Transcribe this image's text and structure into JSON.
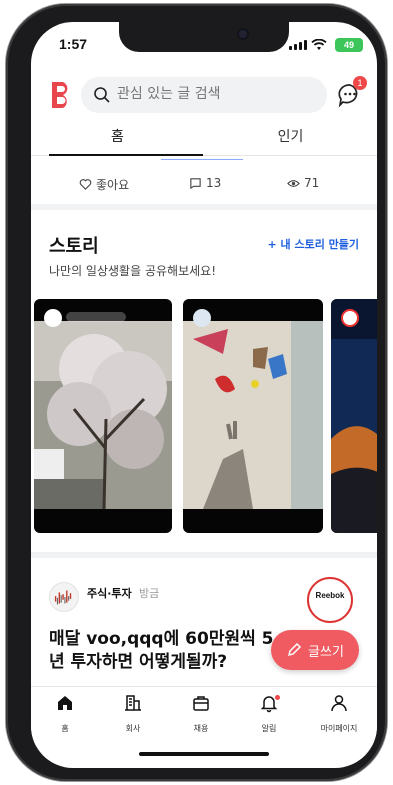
{
  "status_bar": {
    "time": "1:57",
    "battery": "49"
  },
  "header": {
    "search_placeholder": "관심 있는 글 검색",
    "chat_badge": "1"
  },
  "tabs": [
    {
      "label": "홈"
    },
    {
      "label": "인기"
    }
  ],
  "post_actions": {
    "like_label": "좋아요",
    "comment_count": "13",
    "view_count": "71"
  },
  "stories": {
    "title": "스토리",
    "make_button": "+ 내 스토리 만들기",
    "subtitle": "나만의 일상생활을 공유해보세요!"
  },
  "post": {
    "category": "주식·투자",
    "status": "방금",
    "title": "매달 voo,qqq에 60만원씩 5년 투자하면 어떻게될까?"
  },
  "ad": {
    "brand": "Reebok"
  },
  "write_button": {
    "label": "글쓰기"
  },
  "bottom_nav": [
    {
      "label": "홈",
      "icon": "home-icon"
    },
    {
      "label": "회사",
      "icon": "building-icon"
    },
    {
      "label": "채용",
      "icon": "briefcase-icon"
    },
    {
      "label": "알림",
      "icon": "bell-icon"
    },
    {
      "label": "마이페이지",
      "icon": "person-icon"
    }
  ],
  "colors": {
    "accent": "#f05b61",
    "link": "#1e5fe0",
    "brand_logo": "#e8454d"
  }
}
